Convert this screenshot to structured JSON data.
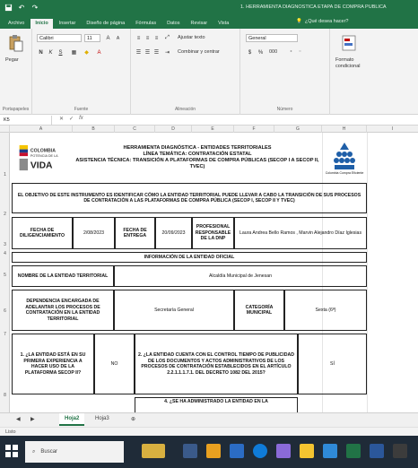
{
  "window": {
    "title": "1. HERRAMIENTA DIAGNOSTICA ETAPA DE COMPRA PUBLICA",
    "quick_access": [
      "save-icon",
      "undo-icon",
      "redo-icon"
    ]
  },
  "ribbon_tabs": [
    "Archivo",
    "Inicio",
    "Insertar",
    "Diseño de página",
    "Fórmulas",
    "Datos",
    "Revisar",
    "Vista"
  ],
  "active_tab": "Inicio",
  "tell_me": "¿Qué desea hacer?",
  "ribbon": {
    "clipboard": {
      "paste_label": "Pegar",
      "group_label": "Portapapeles"
    },
    "font": {
      "font_name": "Calibri",
      "font_size": "11",
      "bold": "N",
      "italic": "K",
      "underline": "S",
      "group_label": "Fuente"
    },
    "alignment": {
      "wrap_text": "Ajustar texto",
      "merge_center": "Combinar y centrar",
      "group_label": "Alineación"
    },
    "number": {
      "format": "General",
      "currency": "$",
      "percent": "%",
      "thousands": "000",
      "group_label": "Número"
    },
    "styles": {
      "conditional_format": "Formato condicional"
    }
  },
  "formula_bar": {
    "name_box": "K5",
    "formula": ""
  },
  "columns": [
    "A",
    "B",
    "C",
    "D",
    "E",
    "F",
    "G",
    "H",
    "I"
  ],
  "rows": [
    "1",
    "2",
    "3",
    "4",
    "5",
    "6",
    "7",
    "8"
  ],
  "sheet": {
    "header_title": "HERRAMIENTA DIAGNÓSTICA - ENTIDADES TERRITORIALES\nLÍNEA TEMÁTICA: CONTRATACIÓN ESTATAL\nASISTENCIA TÉCNICA: TRANSICIÓN A PLATAFORMAS DE COMPRA PÚBLICAS (SECOP I A SECOP II, TVEC)",
    "logo_left_text": "COLOMBIA\nPOTENCIA DE LA\nVIDA",
    "logo_right_caption": "Colombia Compra Eficiente",
    "objective": "EL OBJETIVO DE ESTE INSTRUMENTO ES IDENTIFICAR CÓMO LA ENTIDAD TERRITORIAL PUEDE LLEVAR A CABO LA TRANSICIÓN DE SUS PROCESOS DE CONTRATACIÓN A LAS PLATAFORMAS DE COMPRA PÚBLICA (SECOP I, SECOP II Y TVEC)",
    "fecha_diligenciamiento_label": "FECHA DE DILIGENCIAMIENTO",
    "fecha_diligenciamiento_value": "2/08/2023",
    "fecha_entrega_label": "FECHA DE ENTREGA",
    "fecha_entrega_value": "20/09/2023",
    "profesional_label": "PROFESIONAL RESPONSABLE DE LA DNP",
    "profesional_value": "Laura Andrea Bello Ramos , Marvin Alejandro Díaz Iglesias",
    "section_title": "INFORMACIÓN DE LA ENTIDAD OFICIAL",
    "nombre_label": "NOMBRE DE LA ENTIDAD TERRITORIAL",
    "nombre_value": "Alcaldía Municipal de Jenesan",
    "dependencia_label": "DEPENDENCIA ENCARGADA DE ADELANTAR LOS PROCESOS DE CONTRATACIÓN EN LA ENTIDAD TERRITORIAL",
    "dependencia_value": "Secretaría General",
    "categoria_label": "CATEGORÍA MUNICIPAL",
    "categoria_value": "Sexta (6ª)",
    "q1": "1. ¿LA ENTIDAD ESTÁ EN SU PRIMERA EXPERIENCIA A HACER USO DE LA PLATAFORMA SECOP II?",
    "q1_answer": "NO",
    "q2": "2. ¿LA ENTIDAD CUENTA CON EL CONTROL TIEMPO DE PUBLICIDAD DE LOS DOCUMENTOS Y ACTOS ADMINISTRATIVOS DE LOS PROCESOS DE CONTRATACIÓN ESTABLECIDOS EN EL ARTÍCULO 2.2.1.1.1.7.1. DEL DECRETO 1082 DEL 2015?",
    "q2_answer": "SÍ",
    "q3_partial": "4. ¿SE HA ADMINISTRADO LA ENTIDAD EN LA"
  },
  "sheet_tabs": [
    "Hoja2",
    "Hoja3"
  ],
  "active_sheet": "Hoja2",
  "status": "Listo",
  "taskbar": {
    "search_placeholder": "Buscar"
  }
}
